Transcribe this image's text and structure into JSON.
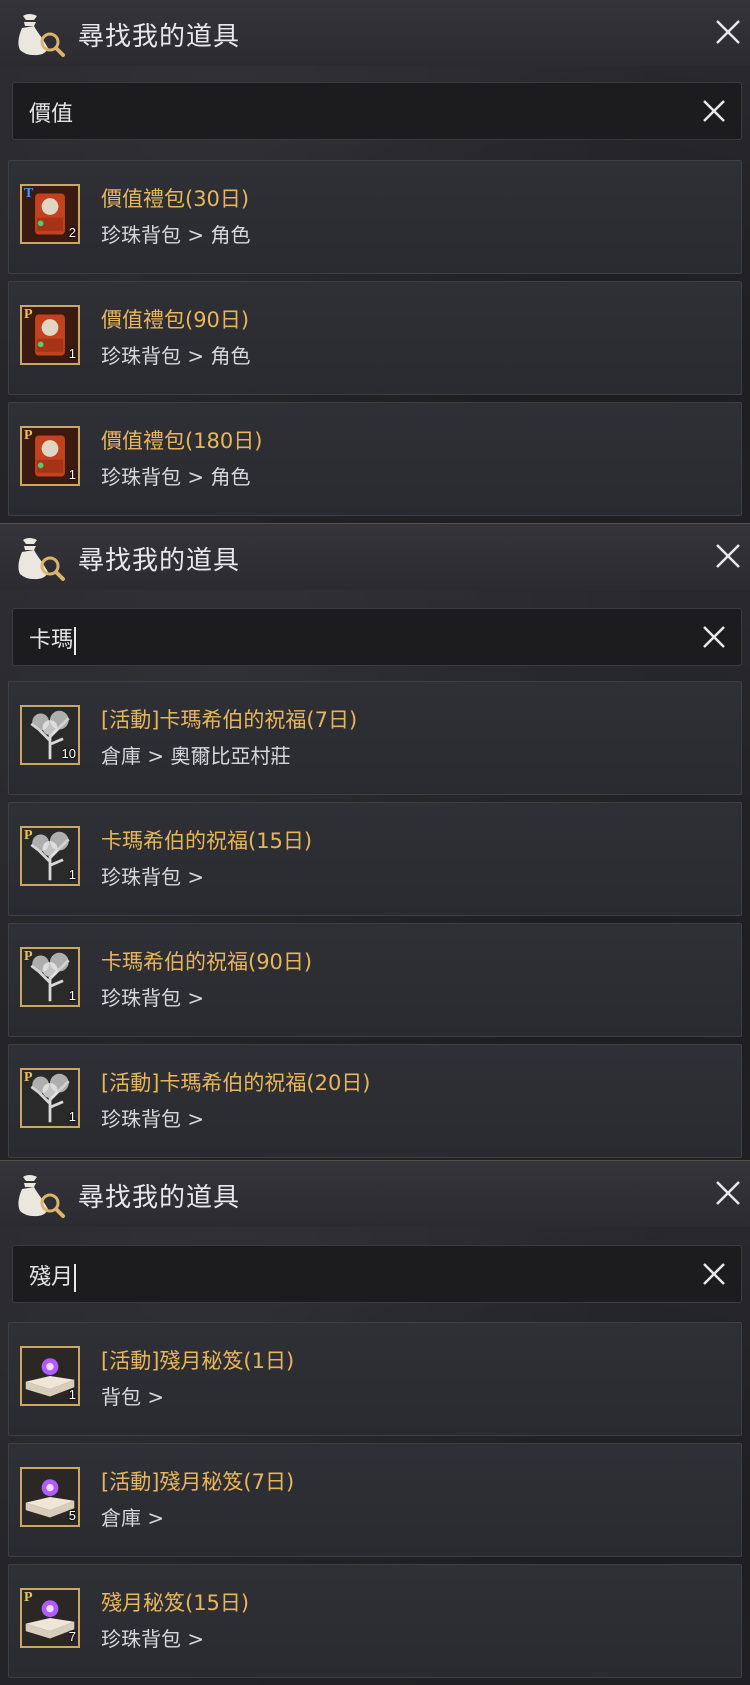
{
  "panels": [
    {
      "title": "尋找我的道具",
      "search_value": "價值",
      "show_caret": false,
      "items": [
        {
          "badge": "T",
          "badge_color": "#3aa0ff",
          "count": "2",
          "name": "價值禮包(30日)",
          "location": "珍珠背包 > 角色",
          "icon": "gift-box-icon"
        },
        {
          "badge": "P",
          "badge_color": "#e8c35a",
          "count": "1",
          "name": "價值禮包(90日)",
          "location": "珍珠背包 > 角色",
          "icon": "gift-box-icon"
        },
        {
          "badge": "P",
          "badge_color": "#e8c35a",
          "count": "1",
          "name": "價值禮包(180日)",
          "location": "珍珠背包 > 角色",
          "icon": "gift-box-icon"
        }
      ]
    },
    {
      "title": "尋找我的道具",
      "search_value": "卡瑪",
      "show_caret": true,
      "items": [
        {
          "badge": "",
          "badge_color": "#e8c35a",
          "count": "10",
          "name": "[活動]卡瑪希伯的祝福(7日)",
          "location": "倉庫 > 奧爾比亞村莊",
          "icon": "tree-icon"
        },
        {
          "badge": "P",
          "badge_color": "#e8c35a",
          "count": "1",
          "name": "卡瑪希伯的祝福(15日)",
          "location": "珍珠背包 >",
          "icon": "tree-icon"
        },
        {
          "badge": "P",
          "badge_color": "#e8c35a",
          "count": "1",
          "name": "卡瑪希伯的祝福(90日)",
          "location": "珍珠背包 >",
          "icon": "tree-icon"
        },
        {
          "badge": "P",
          "badge_color": "#e8c35a",
          "count": "1",
          "name": "[活動]卡瑪希伯的祝福(20日)",
          "location": "珍珠背包 >",
          "icon": "tree-icon"
        }
      ]
    },
    {
      "title": "尋找我的道具",
      "search_value": "殘月",
      "show_caret": true,
      "items": [
        {
          "badge": "",
          "badge_color": "#e8c35a",
          "count": "1",
          "name": "[活動]殘月秘笈(1日)",
          "location": "背包 >",
          "icon": "scroll-book-icon"
        },
        {
          "badge": "",
          "badge_color": "#e8c35a",
          "count": "5",
          "name": "[活動]殘月秘笈(7日)",
          "location": "倉庫 >",
          "icon": "scroll-book-icon"
        },
        {
          "badge": "P",
          "badge_color": "#e8c35a",
          "count": "7",
          "name": "殘月秘笈(15日)",
          "location": "珍珠背包 >",
          "icon": "scroll-book-icon"
        }
      ]
    }
  ]
}
